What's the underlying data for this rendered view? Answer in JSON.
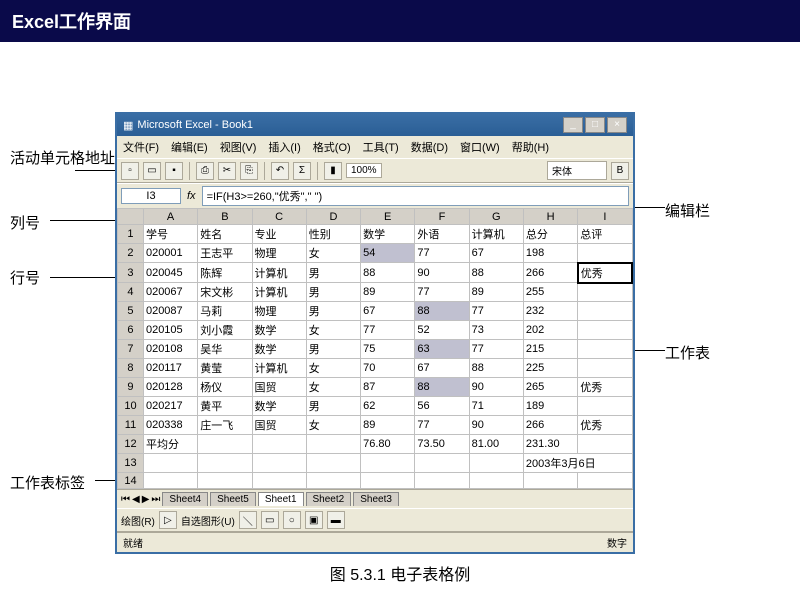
{
  "slide_title": "Excel工作界面",
  "labels": {
    "cell_address": "活动单元格地址",
    "formula_bar": "编辑栏",
    "col_header": "列号",
    "row_header": "行号",
    "worksheet": "工作表",
    "sheet_tabs": "工作表标签"
  },
  "caption": "图 5.3.1 电子表格例",
  "window": {
    "title": "Microsoft Excel - Book1",
    "menus": [
      "文件(F)",
      "编辑(E)",
      "视图(V)",
      "插入(I)",
      "格式(O)",
      "工具(T)",
      "数据(D)",
      "窗口(W)",
      "帮助(H)"
    ],
    "zoom": "100%",
    "font": "宋体",
    "name_box": "I3",
    "fx": "fx",
    "formula": "=IF(H3>=260,\"优秀\",\" \")",
    "columns": [
      "A",
      "B",
      "C",
      "D",
      "E",
      "F",
      "G",
      "H",
      "I"
    ],
    "headers": [
      "学号",
      "姓名",
      "专业",
      "性别",
      "数学",
      "外语",
      "计算机",
      "总分",
      "总评"
    ],
    "rows": [
      [
        "020001",
        "王志平",
        "物理",
        "女",
        "54",
        "77",
        "67",
        "198",
        ""
      ],
      [
        "020045",
        "陈辉",
        "计算机",
        "男",
        "88",
        "90",
        "88",
        "266",
        "优秀"
      ],
      [
        "020067",
        "宋文彬",
        "计算机",
        "男",
        "89",
        "77",
        "89",
        "255",
        ""
      ],
      [
        "020087",
        "马莉",
        "物理",
        "男",
        "67",
        "88",
        "77",
        "232",
        ""
      ],
      [
        "020105",
        "刘小霞",
        "数学",
        "女",
        "77",
        "52",
        "73",
        "202",
        ""
      ],
      [
        "020108",
        "吴华",
        "数学",
        "男",
        "75",
        "63",
        "77",
        "215",
        ""
      ],
      [
        "020117",
        "黄莹",
        "计算机",
        "女",
        "70",
        "67",
        "88",
        "225",
        ""
      ],
      [
        "020128",
        "杨仪",
        "国贸",
        "女",
        "87",
        "88",
        "90",
        "265",
        "优秀"
      ],
      [
        "020217",
        "黄平",
        "数学",
        "男",
        "62",
        "56",
        "71",
        "189",
        ""
      ],
      [
        "020338",
        "庄一飞",
        "国贸",
        "女",
        "89",
        "77",
        "90",
        "266",
        "优秀"
      ]
    ],
    "avg_row": [
      "平均分",
      "",
      "",
      "",
      "76.80",
      "73.50",
      "81.00",
      "231.30",
      ""
    ],
    "date_cell": "2003年3月6日",
    "tabs": [
      "Sheet4",
      "Sheet5",
      "Sheet1",
      "Sheet2",
      "Sheet3"
    ],
    "draw_label": "绘图(R)",
    "autoshape": "自选图形(U)",
    "status_left": "就绪",
    "status_right": "数字"
  }
}
